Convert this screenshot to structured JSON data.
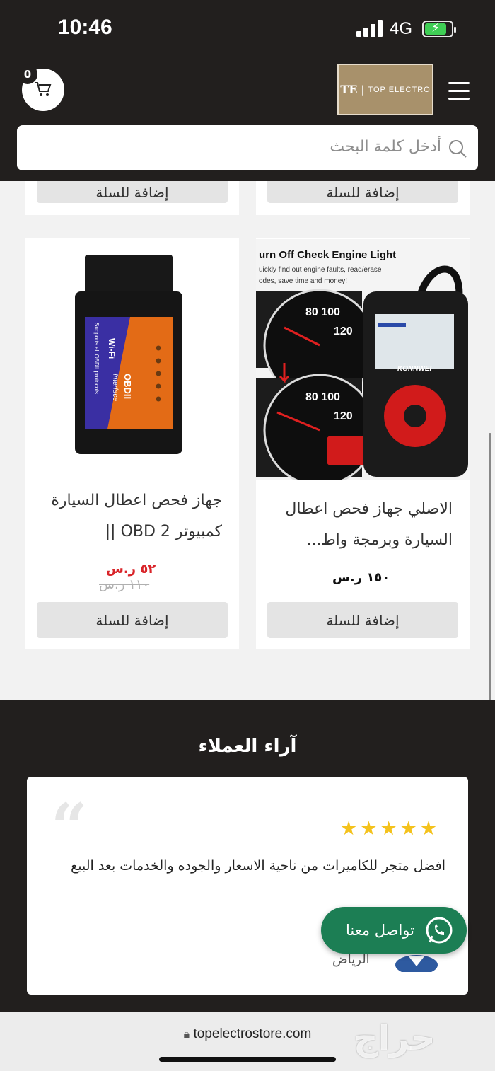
{
  "status_bar": {
    "time": "10:46",
    "network": "4G"
  },
  "header": {
    "cart_count": "0",
    "logo_mark": "TE",
    "logo_name": "TOP ELECTRO"
  },
  "search": {
    "placeholder": "أدخل كلمة البحث"
  },
  "products": [
    {
      "add_label": "إضافة للسلة"
    },
    {
      "add_label": "إضافة للسلة"
    },
    {
      "title_line1": "الاصلي جهاز فحص اعطال",
      "title_line2": "السيارة وبرمجة واط...",
      "price": "١٥٠ ر.س",
      "add_label": "إضافة للسلة",
      "image_caption": "urn Off Check Engine Light",
      "image_sub1": "uickly find out engine faults, read/erase",
      "image_sub2": "odes, save time and money!",
      "image_brand": "KONNWEI"
    },
    {
      "title_line1": "جهاز فحص اعطال السيارة",
      "title_line2": "كمبيوتر OBD 2 ||",
      "sale_price": "٥٢ ر.س",
      "old_price": "١١٠ ر.س",
      "add_label": "إضافة للسلة",
      "image_text1": "Wi-Fi",
      "image_text2": "Supports all OBDII protocols",
      "image_text3": "OBDII",
      "image_text4": "Interface"
    }
  ],
  "reviews": {
    "title": "آراء العملاء",
    "rating": 5,
    "text": "افضل متجر للكاميرات من ناحية الاسعار والجوده والخدمات بعد البيع",
    "city": "الرياض"
  },
  "whatsapp": {
    "label": "تواصل معنا"
  },
  "browser": {
    "url": "topelectrostore.com"
  },
  "watermark": "حراج",
  "colors": {
    "dark": "#221f1e",
    "gold": "#a8916b",
    "whatsapp": "#1c7e54",
    "sale": "#d9252a",
    "star": "#f4c21c"
  }
}
